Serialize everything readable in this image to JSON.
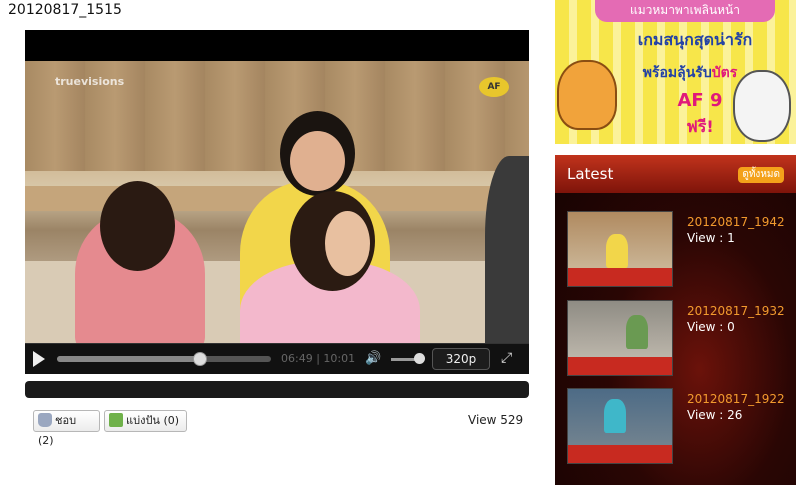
{
  "page": {
    "title": "20120817_1515"
  },
  "player": {
    "watermark": "truevisions",
    "channel_logo": "AF",
    "time": "06:49 | 10:01",
    "quality": "320p",
    "progress": 0.67,
    "volume": 0.75
  },
  "actions": {
    "like_label": "ชอบ (2)",
    "share_label": "แบ่งปัน (0)",
    "views": "View 529"
  },
  "ad": {
    "top_text": "แมวหมาพาเพลินหน้า",
    "line1": "เกมสนุกสุดน่ารัก",
    "line2_a": "พร้อมลุ้นรับ",
    "line2_b": "บัตร",
    "line3": "AF 9",
    "line4": "ฟรี!"
  },
  "latest": {
    "title": "Latest",
    "see_all": "ดูทั้งหมด",
    "items": [
      {
        "title": "20120817_1942",
        "views": "View : 1"
      },
      {
        "title": "20120817_1932",
        "views": "View : 0"
      },
      {
        "title": "20120817_1922",
        "views": "View : 26"
      }
    ]
  },
  "icons": {
    "play": "play-icon",
    "volume": "volume-icon",
    "fullscreen": "fullscreen-icon",
    "like": "thumbs-up-icon",
    "share": "share-icon"
  },
  "colors": {
    "latest_title": "#f29a2e",
    "latest_header": "#c1331c",
    "see_all_badge": "#f4a11a"
  }
}
